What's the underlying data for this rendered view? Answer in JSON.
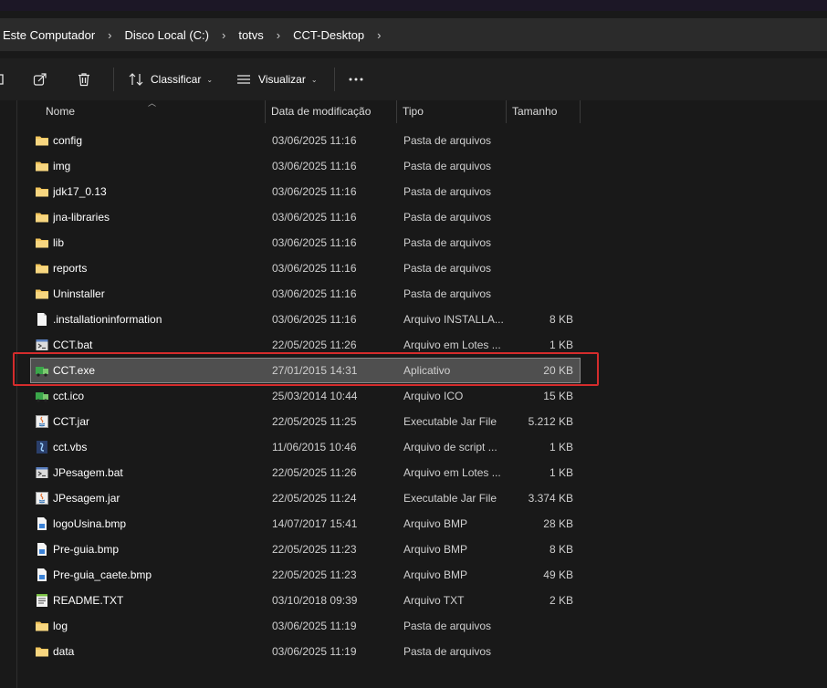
{
  "breadcrumb": [
    "Este Computador",
    "Disco Local (C:)",
    "totvs",
    "CCT-Desktop"
  ],
  "toolbar": {
    "sort_label": "Classificar",
    "view_label": "Visualizar"
  },
  "columns": {
    "name": "Nome",
    "date": "Data de modificação",
    "type": "Tipo",
    "size": "Tamanho"
  },
  "files": [
    {
      "name": "config",
      "date": "03/06/2025 11:16",
      "type": "Pasta de arquivos",
      "size": "",
      "icon": "folder-icon"
    },
    {
      "name": "img",
      "date": "03/06/2025 11:16",
      "type": "Pasta de arquivos",
      "size": "",
      "icon": "folder-icon"
    },
    {
      "name": "jdk17_0.13",
      "date": "03/06/2025 11:16",
      "type": "Pasta de arquivos",
      "size": "",
      "icon": "folder-icon"
    },
    {
      "name": "jna-libraries",
      "date": "03/06/2025 11:16",
      "type": "Pasta de arquivos",
      "size": "",
      "icon": "folder-icon"
    },
    {
      "name": "lib",
      "date": "03/06/2025 11:16",
      "type": "Pasta de arquivos",
      "size": "",
      "icon": "folder-icon"
    },
    {
      "name": "reports",
      "date": "03/06/2025 11:16",
      "type": "Pasta de arquivos",
      "size": "",
      "icon": "folder-icon"
    },
    {
      "name": "Uninstaller",
      "date": "03/06/2025 11:16",
      "type": "Pasta de arquivos",
      "size": "",
      "icon": "folder-icon"
    },
    {
      "name": ".installationinformation",
      "date": "03/06/2025 11:16",
      "type": "Arquivo INSTALLA...",
      "size": "8 KB",
      "icon": "document-icon"
    },
    {
      "name": "CCT.bat",
      "date": "22/05/2025 11:26",
      "type": "Arquivo em Lotes ...",
      "size": "1 KB",
      "icon": "batch-file-icon"
    },
    {
      "name": "CCT.exe",
      "date": "27/01/2015 14:31",
      "type": "Aplicativo",
      "size": "20 KB",
      "icon": "application-icon",
      "selected": true
    },
    {
      "name": "cct.ico",
      "date": "25/03/2014 10:44",
      "type": "Arquivo ICO",
      "size": "15 KB",
      "icon": "application-icon"
    },
    {
      "name": "CCT.jar",
      "date": "22/05/2025 11:25",
      "type": "Executable Jar File",
      "size": "5.212 KB",
      "icon": "java-icon"
    },
    {
      "name": "cct.vbs",
      "date": "11/06/2015 10:46",
      "type": "Arquivo de script ...",
      "size": "1 KB",
      "icon": "script-icon"
    },
    {
      "name": "JPesagem.bat",
      "date": "22/05/2025 11:26",
      "type": "Arquivo em Lotes ...",
      "size": "1 KB",
      "icon": "batch-file-icon"
    },
    {
      "name": "JPesagem.jar",
      "date": "22/05/2025 11:24",
      "type": "Executable Jar File",
      "size": "3.374 KB",
      "icon": "java-icon"
    },
    {
      "name": "logoUsina.bmp",
      "date": "14/07/2017 15:41",
      "type": "Arquivo BMP",
      "size": "28 KB",
      "icon": "image-file-icon"
    },
    {
      "name": "Pre-guia.bmp",
      "date": "22/05/2025 11:23",
      "type": "Arquivo BMP",
      "size": "8 KB",
      "icon": "image-file-icon"
    },
    {
      "name": "Pre-guia_caete.bmp",
      "date": "22/05/2025 11:23",
      "type": "Arquivo BMP",
      "size": "49 KB",
      "icon": "image-file-icon"
    },
    {
      "name": "README.TXT",
      "date": "03/10/2018 09:39",
      "type": "Arquivo TXT",
      "size": "2 KB",
      "icon": "text-file-icon"
    },
    {
      "name": "log",
      "date": "03/06/2025 11:19",
      "type": "Pasta de arquivos",
      "size": "",
      "icon": "folder-icon"
    },
    {
      "name": "data",
      "date": "03/06/2025 11:19",
      "type": "Pasta de arquivos",
      "size": "",
      "icon": "folder-icon"
    }
  ],
  "colors": {
    "folder": "#f2c55c",
    "selection": "#4f4f4f",
    "highlight_box": "#d42c2c"
  }
}
